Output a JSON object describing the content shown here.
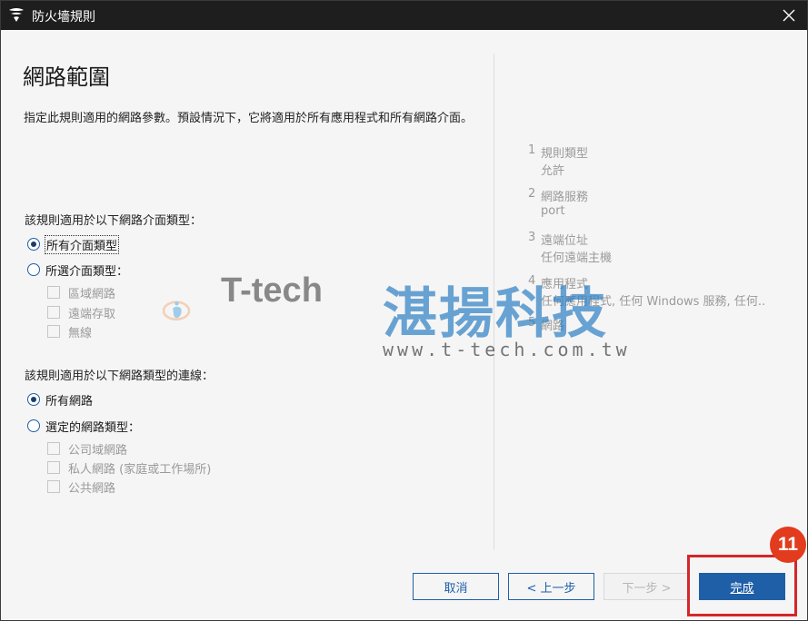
{
  "window": {
    "title": "防火墻規則"
  },
  "page": {
    "heading": "網路範圍",
    "description": "指定此規則適用的網路參數。預設情況下，它將適用於所有應用程式和所有網路介面。"
  },
  "interface_section": {
    "label": "該規則適用於以下網路介面類型：",
    "all_option": "所有介面類型",
    "selected_option": "所選介面類型：",
    "checkboxes": [
      "區域網路",
      "遠端存取",
      "無線"
    ]
  },
  "network_section": {
    "label": "該規則適用於以下網路類型的連線：",
    "all_option": "所有網路",
    "selected_option": "選定的網路類型：",
    "checkboxes": [
      "公司域網路",
      "私人網路 (家庭或工作場所)",
      "公共網路"
    ]
  },
  "steps": [
    {
      "num": "1",
      "name": "規則類型",
      "value": "允許"
    },
    {
      "num": "2",
      "name": "網路服務",
      "value": "port"
    },
    {
      "num": "3",
      "name": "遠端位址",
      "value": "任何遠端主機"
    },
    {
      "num": "4",
      "name": "應用程式",
      "value": "任何應用程式, 任何 Windows 服務, 任何.."
    },
    {
      "num": "5",
      "name": "網路",
      "value": ""
    }
  ],
  "buttons": {
    "cancel": "取消",
    "back": "< 上一步",
    "next": "下一步 >",
    "finish": "完成"
  },
  "annotation": {
    "step_badge": "11"
  },
  "watermark": {
    "brand": "T-tech",
    "chinese": "湛揚科技",
    "url": "www.t-tech.com.tw"
  },
  "colors": {
    "accent": "#1f5fa8",
    "titlebar": "#1e1e1e",
    "highlight": "#d6262a",
    "badge": "#e23b1e"
  }
}
